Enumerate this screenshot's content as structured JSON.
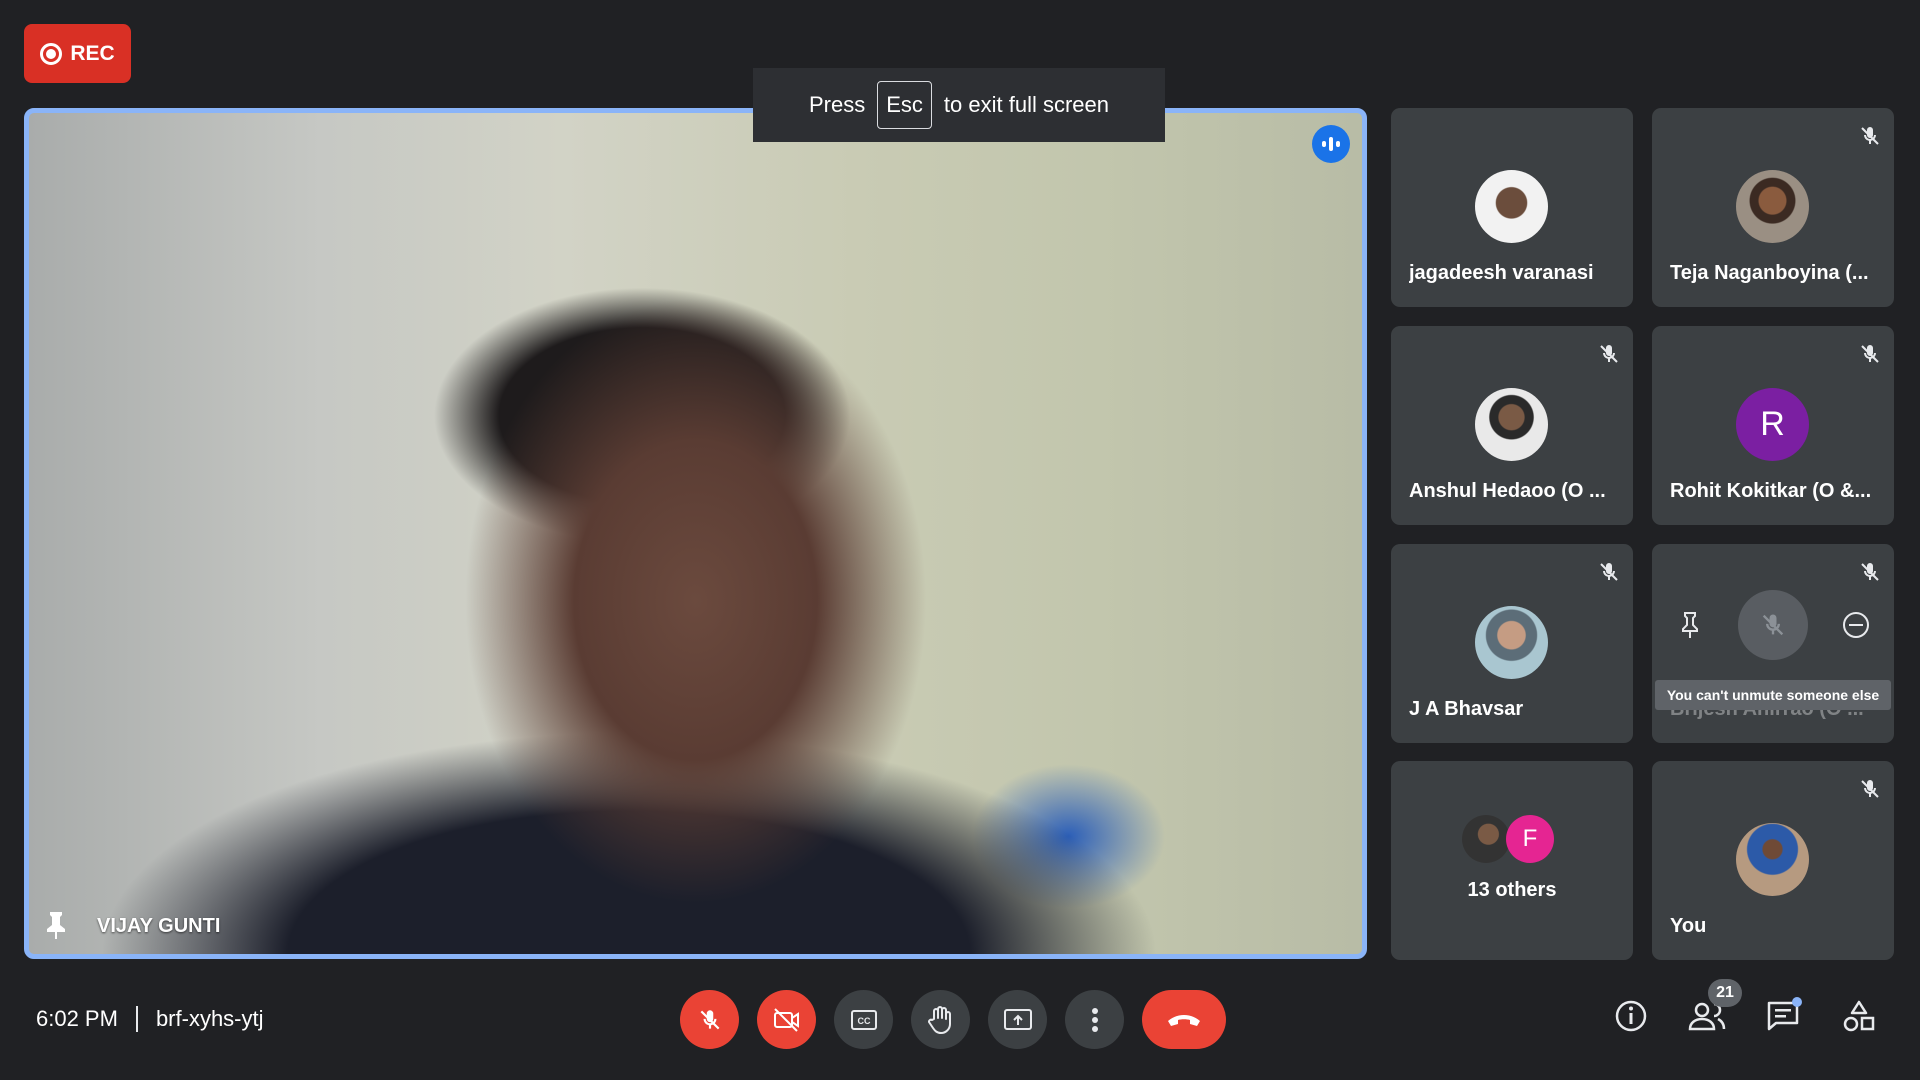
{
  "recording": {
    "label": "REC"
  },
  "toast": {
    "prefix": "Press",
    "key": "Esc",
    "suffix": "to exit full screen"
  },
  "main_speaker": {
    "name": "VIJAY GUNTI"
  },
  "participants": [
    {
      "name": "jagadeesh varanasi"
    },
    {
      "name": "Teja Naganboyina (..."
    },
    {
      "name": "Anshul Hedaoo (O ..."
    },
    {
      "name": "Rohit Kokitkar (O &...",
      "initial": "R"
    },
    {
      "name": "J A Bhavsar"
    },
    {
      "name": "Brijesh Ahirrao (O ...",
      "tooltip": "You can't unmute someone else"
    },
    {
      "others_label": "13 others",
      "initial": "F"
    },
    {
      "name": "You"
    }
  ],
  "meeting": {
    "time": "6:02 PM",
    "code": "brf-xyhs-ytj"
  },
  "people_count": "21",
  "colors": {
    "background": "#202124",
    "tile": "#3c4043",
    "accent_blue": "#8ab4f8",
    "danger_red": "#ea4335",
    "rec_red": "#d93025"
  },
  "icons": {
    "recording": "record-icon",
    "speaking": "audio-wave-icon",
    "pin": "pin-icon",
    "muted": "mic-off-icon",
    "camera_off": "camera-off-icon",
    "captions": "captions-icon",
    "raise_hand": "hand-icon",
    "present": "present-screen-icon",
    "more": "more-vert-icon",
    "end_call": "phone-hangup-icon",
    "info": "info-icon",
    "people": "people-icon",
    "chat": "chat-icon",
    "activities": "activities-icon",
    "remove": "remove-circle-icon"
  }
}
